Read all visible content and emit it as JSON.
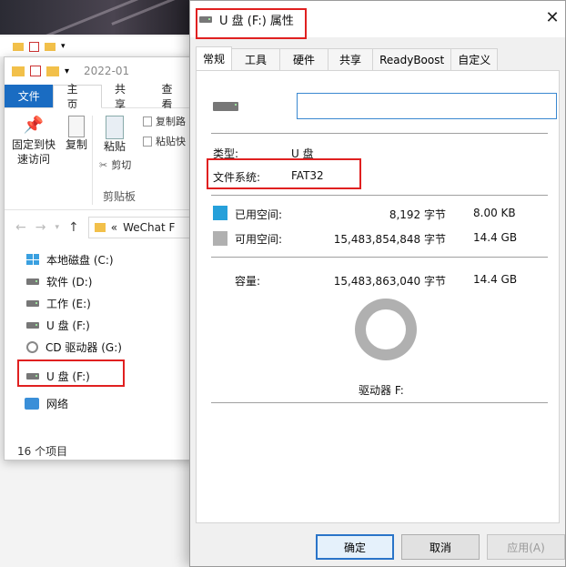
{
  "explorer": {
    "title_path": "2022-01",
    "tabs": {
      "file": "文件",
      "home": "主页",
      "share": "共享",
      "view": "查看"
    },
    "ribbon": {
      "pin": "固定到快\n速访问",
      "copy": "复制",
      "paste": "粘贴",
      "copy_path": "复制路",
      "paste_shortcut": "粘贴快",
      "cut": "剪切",
      "group": "剪贴板"
    },
    "address": {
      "prefix": "«",
      "path": "WeChat F"
    },
    "nav": [
      {
        "label": "本地磁盘 (C:)",
        "icon": "windows-drive-icon"
      },
      {
        "label": "软件 (D:)",
        "icon": "drive-icon"
      },
      {
        "label": "工作 (E:)",
        "icon": "drive-icon"
      },
      {
        "label": "U 盘 (F:)",
        "icon": "usb-drive-icon"
      },
      {
        "label": "CD 驱动器 (G:)",
        "icon": "cd-drive-icon"
      }
    ],
    "selected_drive": "U 盘 (F:)",
    "network": "网络",
    "status": "16 个项目"
  },
  "dialog": {
    "title": "U 盘 (F:) 属性",
    "tabs": [
      "常规",
      "工具",
      "硬件",
      "共享",
      "ReadyBoost",
      "自定义"
    ],
    "name_value": "",
    "type_label": "类型:",
    "type_value": "U 盘",
    "fs_label": "文件系统:",
    "fs_value": "FAT32",
    "used": {
      "label": "已用空间:",
      "bytes": "8,192 字节",
      "size": "8.00 KB",
      "color": "#26a0da"
    },
    "free": {
      "label": "可用空间:",
      "bytes": "15,483,854,848 字节",
      "size": "14.4 GB",
      "color": "#b0b0b0"
    },
    "capacity": {
      "label": "容量:",
      "bytes": "15,483,863,040 字节",
      "size": "14.4 GB"
    },
    "drive_label": "驱动器 F:",
    "buttons": {
      "ok": "确定",
      "cancel": "取消",
      "apply": "应用(A)"
    }
  }
}
